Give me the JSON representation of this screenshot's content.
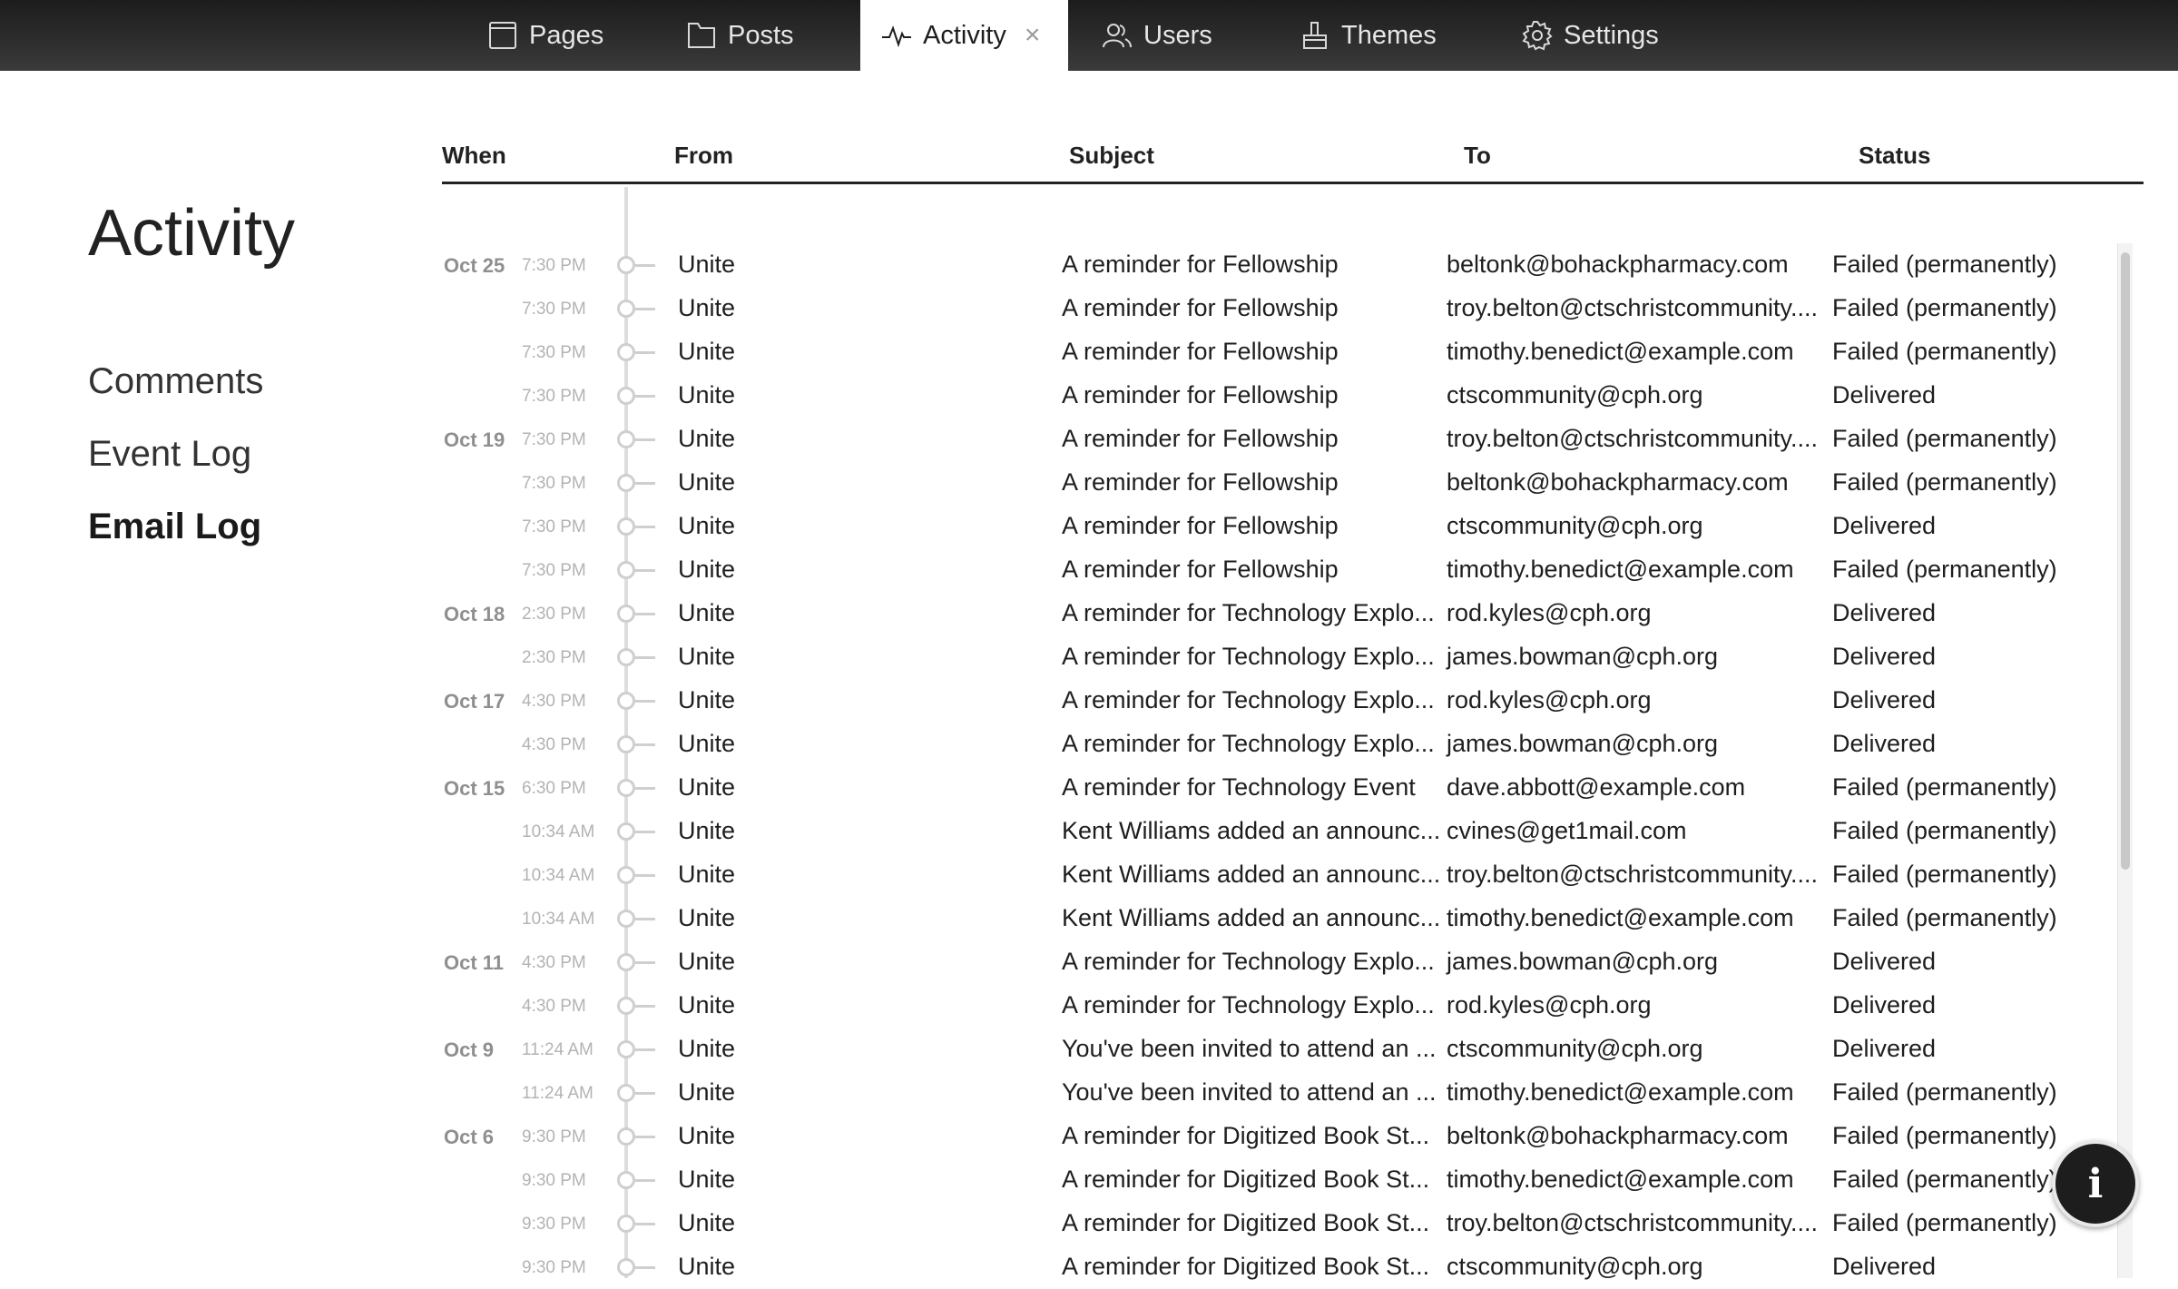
{
  "nav": {
    "tabs": [
      {
        "label": "Pages",
        "icon": "page-icon"
      },
      {
        "label": "Posts",
        "icon": "folder-icon"
      },
      {
        "label": "Activity",
        "icon": "activity-icon",
        "active": true,
        "close": "×"
      },
      {
        "label": "Users",
        "icon": "users-icon"
      },
      {
        "label": "Themes",
        "icon": "brush-icon"
      },
      {
        "label": "Settings",
        "icon": "gear-icon"
      }
    ]
  },
  "page": {
    "title": "Activity"
  },
  "sidebar": {
    "items": [
      {
        "label": "Comments"
      },
      {
        "label": "Event Log"
      },
      {
        "label": "Email Log",
        "active": true
      }
    ]
  },
  "table": {
    "headers": {
      "when": "When",
      "from": "From",
      "subject": "Subject",
      "to": "To",
      "status": "Status"
    },
    "rows": [
      {
        "date": "Oct 25",
        "time": "7:30 PM",
        "from": "Unite",
        "subject": "A reminder for Fellowship",
        "to": "beltonk@bohackpharmacy.com",
        "status": "Failed (permanently)"
      },
      {
        "date": "",
        "time": "7:30 PM",
        "from": "Unite",
        "subject": "A reminder for Fellowship",
        "to": "troy.belton@ctschristcommunity....",
        "status": "Failed (permanently)"
      },
      {
        "date": "",
        "time": "7:30 PM",
        "from": "Unite",
        "subject": "A reminder for Fellowship",
        "to": "timothy.benedict@example.com",
        "status": "Failed (permanently)"
      },
      {
        "date": "",
        "time": "7:30 PM",
        "from": "Unite",
        "subject": "A reminder for Fellowship",
        "to": "ctscommunity@cph.org",
        "status": "Delivered"
      },
      {
        "date": "Oct 19",
        "time": "7:30 PM",
        "from": "Unite",
        "subject": "A reminder for Fellowship",
        "to": "troy.belton@ctschristcommunity....",
        "status": "Failed (permanently)"
      },
      {
        "date": "",
        "time": "7:30 PM",
        "from": "Unite",
        "subject": "A reminder for Fellowship",
        "to": "beltonk@bohackpharmacy.com",
        "status": "Failed (permanently)"
      },
      {
        "date": "",
        "time": "7:30 PM",
        "from": "Unite",
        "subject": "A reminder for Fellowship",
        "to": "ctscommunity@cph.org",
        "status": "Delivered"
      },
      {
        "date": "",
        "time": "7:30 PM",
        "from": "Unite",
        "subject": "A reminder for Fellowship",
        "to": "timothy.benedict@example.com",
        "status": "Failed (permanently)"
      },
      {
        "date": "Oct 18",
        "time": "2:30 PM",
        "from": "Unite",
        "subject": "A reminder for Technology Explo...",
        "to": "rod.kyles@cph.org",
        "status": "Delivered"
      },
      {
        "date": "",
        "time": "2:30 PM",
        "from": "Unite",
        "subject": "A reminder for Technology Explo...",
        "to": "james.bowman@cph.org",
        "status": "Delivered"
      },
      {
        "date": "Oct 17",
        "time": "4:30 PM",
        "from": "Unite",
        "subject": "A reminder for Technology Explo...",
        "to": "rod.kyles@cph.org",
        "status": "Delivered"
      },
      {
        "date": "",
        "time": "4:30 PM",
        "from": "Unite",
        "subject": "A reminder for Technology Explo...",
        "to": "james.bowman@cph.org",
        "status": "Delivered"
      },
      {
        "date": "Oct 15",
        "time": "6:30 PM",
        "from": "Unite",
        "subject": "A reminder for Technology Event",
        "to": "dave.abbott@example.com",
        "status": "Failed (permanently)"
      },
      {
        "date": "",
        "time": "10:34 AM",
        "from": "Unite",
        "subject": "Kent Williams added an announc...",
        "to": "cvines@get1mail.com",
        "status": "Failed (permanently)"
      },
      {
        "date": "",
        "time": "10:34 AM",
        "from": "Unite",
        "subject": "Kent Williams added an announc...",
        "to": "troy.belton@ctschristcommunity....",
        "status": "Failed (permanently)"
      },
      {
        "date": "",
        "time": "10:34 AM",
        "from": "Unite",
        "subject": "Kent Williams added an announc...",
        "to": "timothy.benedict@example.com",
        "status": "Failed (permanently)"
      },
      {
        "date": "Oct 11",
        "time": "4:30 PM",
        "from": "Unite",
        "subject": "A reminder for Technology Explo...",
        "to": "james.bowman@cph.org",
        "status": "Delivered"
      },
      {
        "date": "",
        "time": "4:30 PM",
        "from": "Unite",
        "subject": "A reminder for Technology Explo...",
        "to": "rod.kyles@cph.org",
        "status": "Delivered"
      },
      {
        "date": "Oct 9",
        "time": "11:24 AM",
        "from": "Unite",
        "subject": "You've been invited to attend an ...",
        "to": "ctscommunity@cph.org",
        "status": "Delivered"
      },
      {
        "date": "",
        "time": "11:24 AM",
        "from": "Unite",
        "subject": "You've been invited to attend an ...",
        "to": "timothy.benedict@example.com",
        "status": "Failed (permanently)"
      },
      {
        "date": "Oct 6",
        "time": "9:30 PM",
        "from": "Unite",
        "subject": "A reminder for Digitized Book St...",
        "to": "beltonk@bohackpharmacy.com",
        "status": "Failed (permanently)"
      },
      {
        "date": "",
        "time": "9:30 PM",
        "from": "Unite",
        "subject": "A reminder for Digitized Book St...",
        "to": "timothy.benedict@example.com",
        "status": "Failed (permanently)"
      },
      {
        "date": "",
        "time": "9:30 PM",
        "from": "Unite",
        "subject": "A reminder for Digitized Book St...",
        "to": "troy.belton@ctschristcommunity....",
        "status": "Failed (permanently)"
      },
      {
        "date": "",
        "time": "9:30 PM",
        "from": "Unite",
        "subject": "A reminder for Digitized Book St...",
        "to": "ctscommunity@cph.org",
        "status": "Delivered"
      }
    ]
  },
  "fab": {
    "label": "i",
    "icon": "info-icon"
  }
}
